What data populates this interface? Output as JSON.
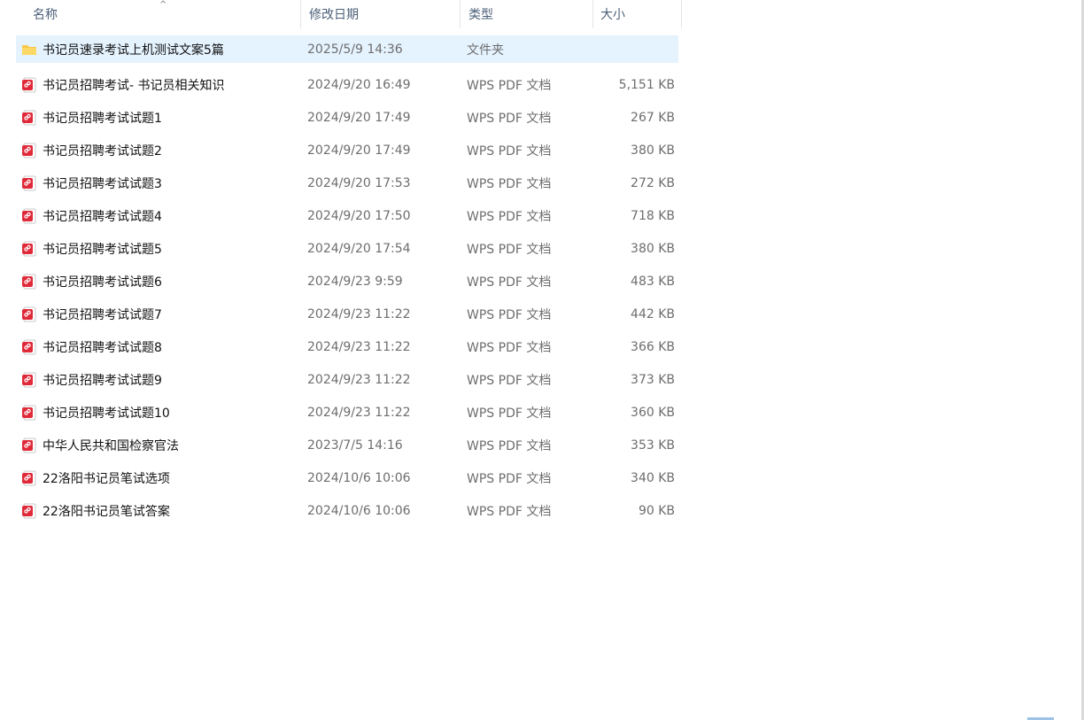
{
  "columns": {
    "name": "名称",
    "date": "修改日期",
    "type": "类型",
    "size": "大小"
  },
  "sort_indicator": "^",
  "files": [
    {
      "icon": "folder-icon",
      "name": "书记员速录考试上机测试文案5篇",
      "date": "2025/5/9 14:36",
      "type": "文件夹",
      "size": ""
    },
    {
      "icon": "pdf-icon",
      "name": "书记员招聘考试- 书记员相关知识",
      "date": "2024/9/20 16:49",
      "type": "WPS PDF 文档",
      "size": "5,151 KB"
    },
    {
      "icon": "pdf-icon",
      "name": "书记员招聘考试试题1",
      "date": "2024/9/20 17:49",
      "type": "WPS PDF 文档",
      "size": "267 KB"
    },
    {
      "icon": "pdf-icon",
      "name": "书记员招聘考试试题2",
      "date": "2024/9/20 17:49",
      "type": "WPS PDF 文档",
      "size": "380 KB"
    },
    {
      "icon": "pdf-icon",
      "name": "书记员招聘考试试题3",
      "date": "2024/9/20 17:53",
      "type": "WPS PDF 文档",
      "size": "272 KB"
    },
    {
      "icon": "pdf-icon",
      "name": "书记员招聘考试试题4",
      "date": "2024/9/20 17:50",
      "type": "WPS PDF 文档",
      "size": "718 KB"
    },
    {
      "icon": "pdf-icon",
      "name": "书记员招聘考试试题5",
      "date": "2024/9/20 17:54",
      "type": "WPS PDF 文档",
      "size": "380 KB"
    },
    {
      "icon": "pdf-icon",
      "name": "书记员招聘考试试题6",
      "date": "2024/9/23 9:59",
      "type": "WPS PDF 文档",
      "size": "483 KB"
    },
    {
      "icon": "pdf-icon",
      "name": "书记员招聘考试试题7",
      "date": "2024/9/23 11:22",
      "type": "WPS PDF 文档",
      "size": "442 KB"
    },
    {
      "icon": "pdf-icon",
      "name": "书记员招聘考试试题8",
      "date": "2024/9/23 11:22",
      "type": "WPS PDF 文档",
      "size": "366 KB"
    },
    {
      "icon": "pdf-icon",
      "name": "书记员招聘考试试题9",
      "date": "2024/9/23 11:22",
      "type": "WPS PDF 文档",
      "size": "373 KB"
    },
    {
      "icon": "pdf-icon",
      "name": "书记员招聘考试试题10",
      "date": "2024/9/23 11:22",
      "type": "WPS PDF 文档",
      "size": "360 KB"
    },
    {
      "icon": "pdf-icon",
      "name": "中华人民共和国检察官法",
      "date": "2023/7/5 14:16",
      "type": "WPS PDF 文档",
      "size": "353 KB"
    },
    {
      "icon": "pdf-icon",
      "name": "22洛阳书记员笔试选项",
      "date": "2024/10/6 10:06",
      "type": "WPS PDF 文档",
      "size": "340 KB"
    },
    {
      "icon": "pdf-icon",
      "name": "22洛阳书记员笔试答案",
      "date": "2024/10/6 10:06",
      "type": "WPS PDF 文档",
      "size": "90 KB"
    }
  ],
  "colors": {
    "selection": "#e5f3ff",
    "folder": "#f8c94a",
    "pdf": "#e02a3a",
    "header_text": "#4c607a"
  }
}
